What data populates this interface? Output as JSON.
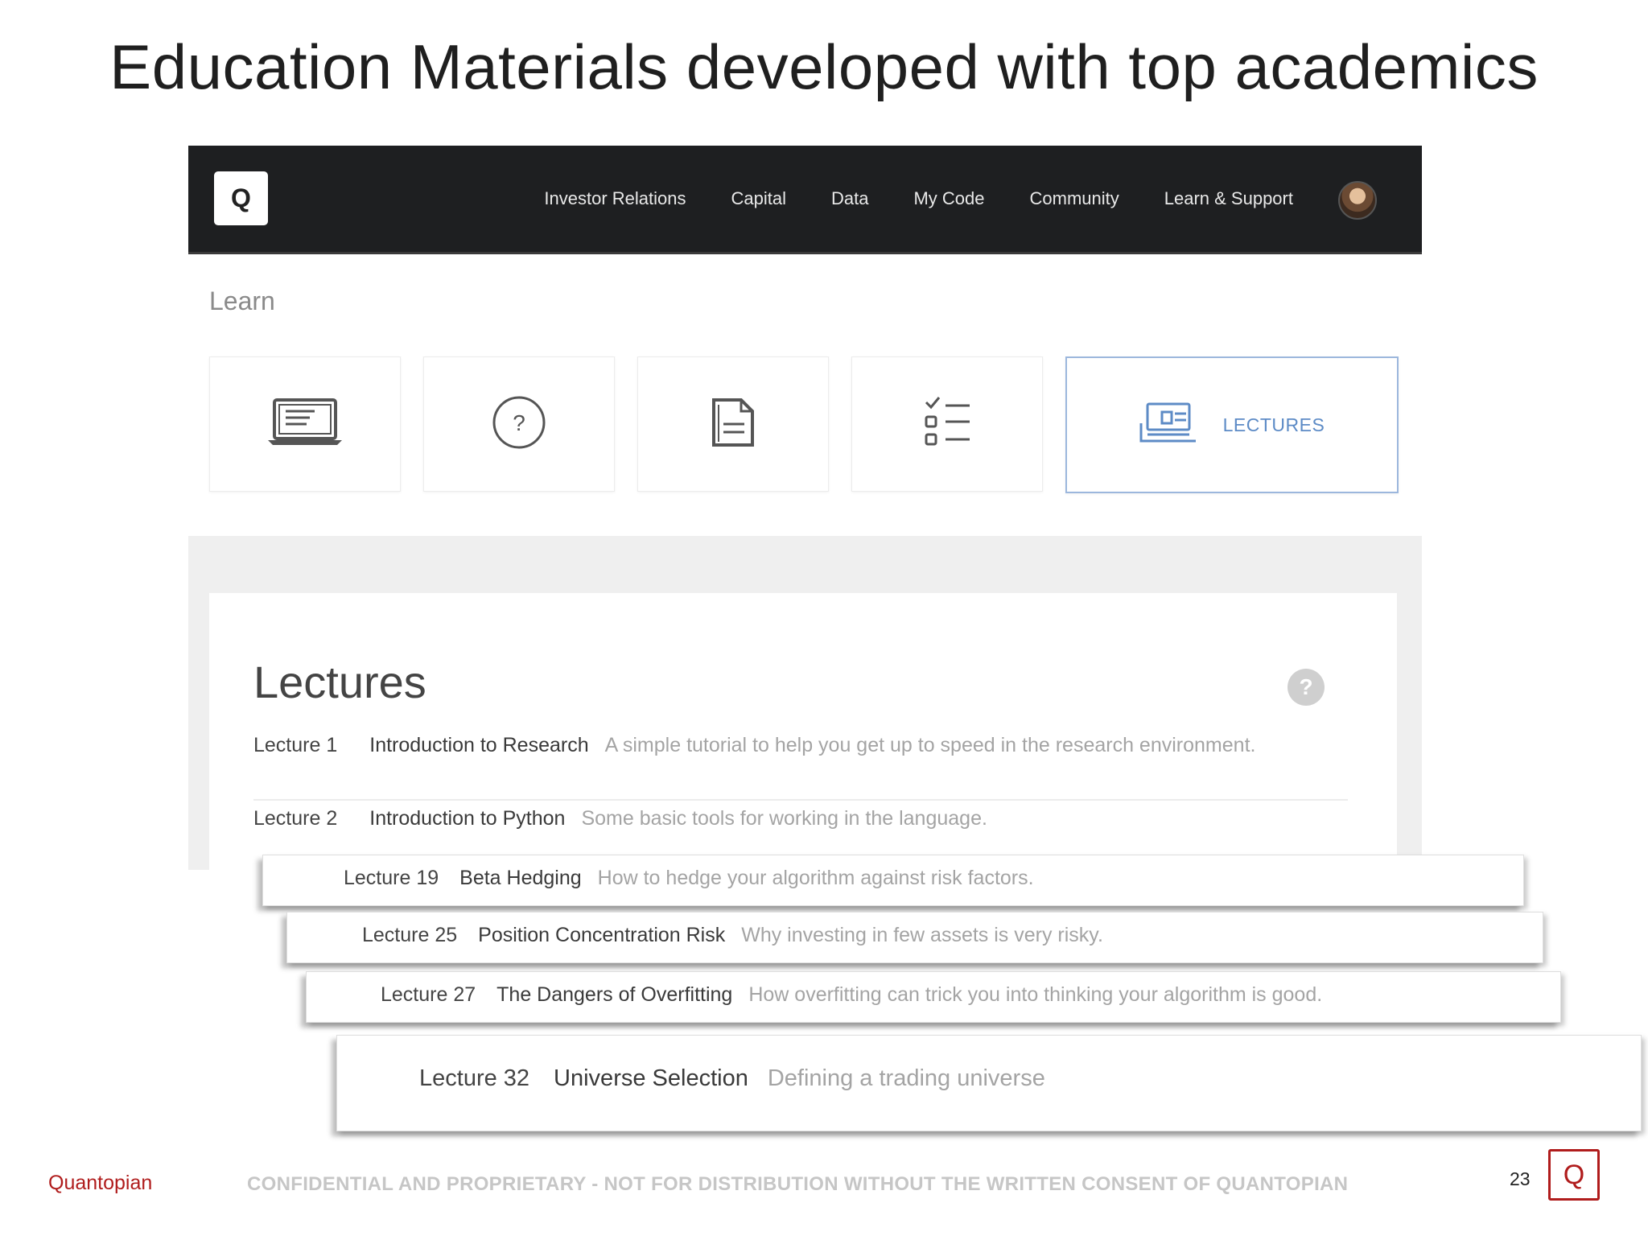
{
  "slide": {
    "title": "Education Materials developed with top academics"
  },
  "app": {
    "logo_letter": "Q",
    "nav": [
      {
        "label": "Investor Relations"
      },
      {
        "label": "Capital"
      },
      {
        "label": "Data"
      },
      {
        "label": "My Code"
      },
      {
        "label": "Community"
      },
      {
        "label": "Learn & Support"
      }
    ],
    "learn_label": "Learn",
    "cards": [
      {
        "icon": "laptop-icon"
      },
      {
        "icon": "question-circle-icon"
      },
      {
        "icon": "document-icon"
      },
      {
        "icon": "checklist-icon"
      },
      {
        "icon": "lectures-icon",
        "label": "LECTURES",
        "active": true
      }
    ],
    "lectures_heading": "Lectures",
    "help_glyph": "?",
    "lectures": [
      {
        "num": "Lecture 1",
        "title": "Introduction to Research",
        "desc": "A simple tutorial to help you get up to speed in the research environment."
      },
      {
        "num": "Lecture 2",
        "title": "Introduction to Python",
        "desc": "Some basic tools for working in the language."
      }
    ],
    "stacked": [
      {
        "num": "Lecture 19",
        "title": "Beta Hedging",
        "desc": "How to hedge your algorithm against risk factors."
      },
      {
        "num": "Lecture 25",
        "title": "Position Concentration Risk",
        "desc": "Why investing in few assets is very risky."
      },
      {
        "num": "Lecture 27",
        "title": "The Dangers of Overfitting",
        "desc": "How overfitting can trick you into thinking your algorithm is good."
      },
      {
        "num": "Lecture 32",
        "title": "Universe Selection",
        "desc": "Defining a trading universe"
      }
    ]
  },
  "footer": {
    "brand": "Quantopian",
    "notice": "CONFIDENTIAL AND PROPRIETARY - NOT FOR DISTRIBUTION WITHOUT THE WRITTEN CONSENT OF QUANTOPIAN",
    "page": "23",
    "logo_letter": "Q"
  },
  "colors": {
    "brand_red": "#b01c1c",
    "nav_bg": "#1e1f21",
    "accent_blue": "#5d8bc6"
  }
}
